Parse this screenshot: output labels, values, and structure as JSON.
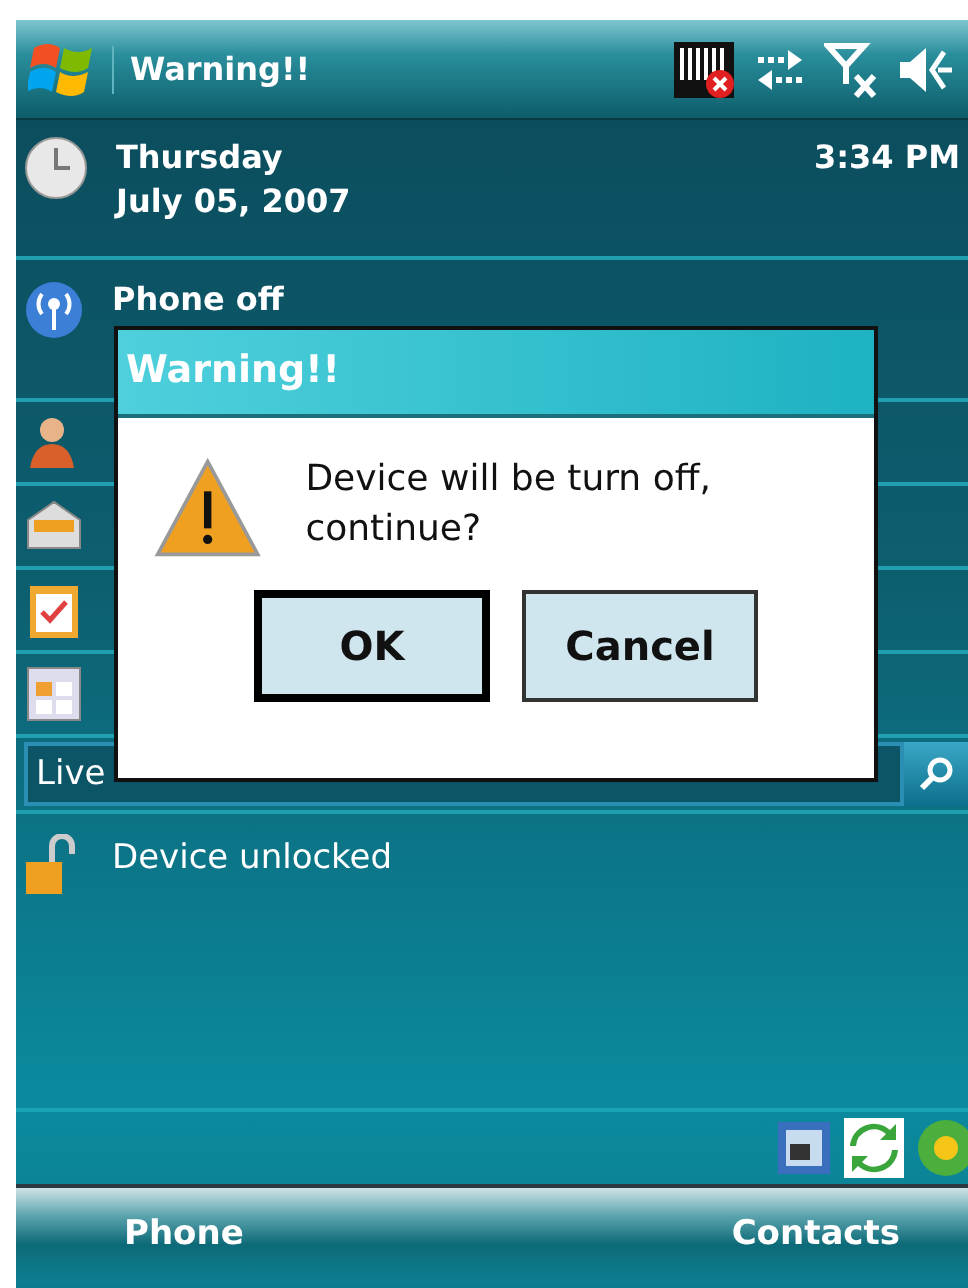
{
  "title_bar": {
    "title": "Warning!!"
  },
  "today": {
    "day": "Thursday",
    "date": "July 05, 2007",
    "time": "3:34 PM"
  },
  "phone_status": "Phone off",
  "search": {
    "value": "Live"
  },
  "lock_status": "Device unlocked",
  "softkeys": [
    "Phone",
    "Contacts"
  ],
  "dialog": {
    "title": "Warning!!",
    "message": "Device will be turn off, continue?",
    "buttons": [
      {
        "label": "OK",
        "focused": true
      },
      {
        "label": "Cancel",
        "focused": false
      }
    ]
  }
}
